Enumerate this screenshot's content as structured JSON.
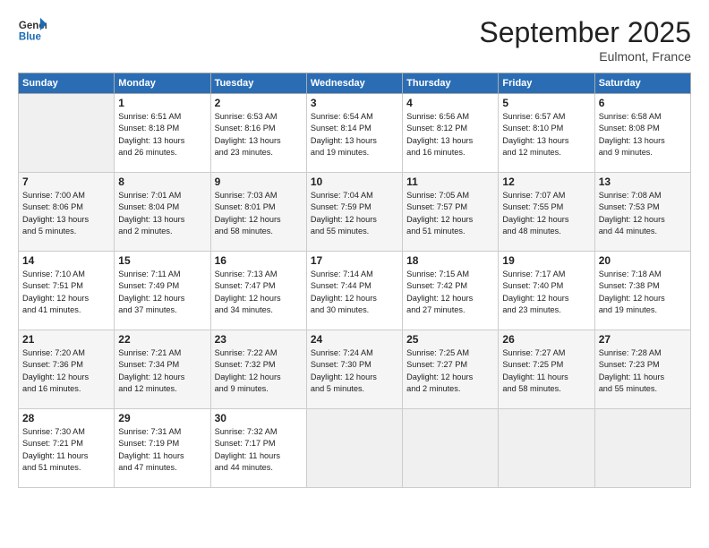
{
  "header": {
    "logo": {
      "general": "General",
      "blue": "Blue"
    },
    "title": "September 2025",
    "subtitle": "Eulmont, France"
  },
  "weekdays": [
    "Sunday",
    "Monday",
    "Tuesday",
    "Wednesday",
    "Thursday",
    "Friday",
    "Saturday"
  ],
  "weeks": [
    [
      {
        "day": "",
        "info": ""
      },
      {
        "day": "1",
        "info": "Sunrise: 6:51 AM\nSunset: 8:18 PM\nDaylight: 13 hours\nand 26 minutes."
      },
      {
        "day": "2",
        "info": "Sunrise: 6:53 AM\nSunset: 8:16 PM\nDaylight: 13 hours\nand 23 minutes."
      },
      {
        "day": "3",
        "info": "Sunrise: 6:54 AM\nSunset: 8:14 PM\nDaylight: 13 hours\nand 19 minutes."
      },
      {
        "day": "4",
        "info": "Sunrise: 6:56 AM\nSunset: 8:12 PM\nDaylight: 13 hours\nand 16 minutes."
      },
      {
        "day": "5",
        "info": "Sunrise: 6:57 AM\nSunset: 8:10 PM\nDaylight: 13 hours\nand 12 minutes."
      },
      {
        "day": "6",
        "info": "Sunrise: 6:58 AM\nSunset: 8:08 PM\nDaylight: 13 hours\nand 9 minutes."
      }
    ],
    [
      {
        "day": "7",
        "info": "Sunrise: 7:00 AM\nSunset: 8:06 PM\nDaylight: 13 hours\nand 5 minutes."
      },
      {
        "day": "8",
        "info": "Sunrise: 7:01 AM\nSunset: 8:04 PM\nDaylight: 13 hours\nand 2 minutes."
      },
      {
        "day": "9",
        "info": "Sunrise: 7:03 AM\nSunset: 8:01 PM\nDaylight: 12 hours\nand 58 minutes."
      },
      {
        "day": "10",
        "info": "Sunrise: 7:04 AM\nSunset: 7:59 PM\nDaylight: 12 hours\nand 55 minutes."
      },
      {
        "day": "11",
        "info": "Sunrise: 7:05 AM\nSunset: 7:57 PM\nDaylight: 12 hours\nand 51 minutes."
      },
      {
        "day": "12",
        "info": "Sunrise: 7:07 AM\nSunset: 7:55 PM\nDaylight: 12 hours\nand 48 minutes."
      },
      {
        "day": "13",
        "info": "Sunrise: 7:08 AM\nSunset: 7:53 PM\nDaylight: 12 hours\nand 44 minutes."
      }
    ],
    [
      {
        "day": "14",
        "info": "Sunrise: 7:10 AM\nSunset: 7:51 PM\nDaylight: 12 hours\nand 41 minutes."
      },
      {
        "day": "15",
        "info": "Sunrise: 7:11 AM\nSunset: 7:49 PM\nDaylight: 12 hours\nand 37 minutes."
      },
      {
        "day": "16",
        "info": "Sunrise: 7:13 AM\nSunset: 7:47 PM\nDaylight: 12 hours\nand 34 minutes."
      },
      {
        "day": "17",
        "info": "Sunrise: 7:14 AM\nSunset: 7:44 PM\nDaylight: 12 hours\nand 30 minutes."
      },
      {
        "day": "18",
        "info": "Sunrise: 7:15 AM\nSunset: 7:42 PM\nDaylight: 12 hours\nand 27 minutes."
      },
      {
        "day": "19",
        "info": "Sunrise: 7:17 AM\nSunset: 7:40 PM\nDaylight: 12 hours\nand 23 minutes."
      },
      {
        "day": "20",
        "info": "Sunrise: 7:18 AM\nSunset: 7:38 PM\nDaylight: 12 hours\nand 19 minutes."
      }
    ],
    [
      {
        "day": "21",
        "info": "Sunrise: 7:20 AM\nSunset: 7:36 PM\nDaylight: 12 hours\nand 16 minutes."
      },
      {
        "day": "22",
        "info": "Sunrise: 7:21 AM\nSunset: 7:34 PM\nDaylight: 12 hours\nand 12 minutes."
      },
      {
        "day": "23",
        "info": "Sunrise: 7:22 AM\nSunset: 7:32 PM\nDaylight: 12 hours\nand 9 minutes."
      },
      {
        "day": "24",
        "info": "Sunrise: 7:24 AM\nSunset: 7:30 PM\nDaylight: 12 hours\nand 5 minutes."
      },
      {
        "day": "25",
        "info": "Sunrise: 7:25 AM\nSunset: 7:27 PM\nDaylight: 12 hours\nand 2 minutes."
      },
      {
        "day": "26",
        "info": "Sunrise: 7:27 AM\nSunset: 7:25 PM\nDaylight: 11 hours\nand 58 minutes."
      },
      {
        "day": "27",
        "info": "Sunrise: 7:28 AM\nSunset: 7:23 PM\nDaylight: 11 hours\nand 55 minutes."
      }
    ],
    [
      {
        "day": "28",
        "info": "Sunrise: 7:30 AM\nSunset: 7:21 PM\nDaylight: 11 hours\nand 51 minutes."
      },
      {
        "day": "29",
        "info": "Sunrise: 7:31 AM\nSunset: 7:19 PM\nDaylight: 11 hours\nand 47 minutes."
      },
      {
        "day": "30",
        "info": "Sunrise: 7:32 AM\nSunset: 7:17 PM\nDaylight: 11 hours\nand 44 minutes."
      },
      {
        "day": "",
        "info": ""
      },
      {
        "day": "",
        "info": ""
      },
      {
        "day": "",
        "info": ""
      },
      {
        "day": "",
        "info": ""
      }
    ]
  ]
}
